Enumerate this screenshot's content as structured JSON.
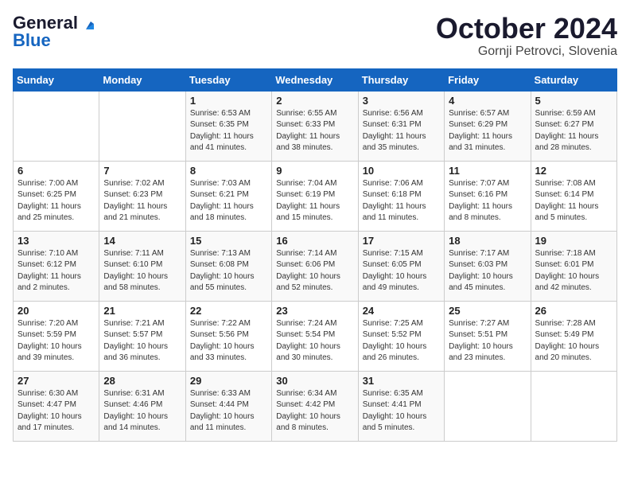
{
  "header": {
    "logo_line1": "General",
    "logo_line2": "Blue",
    "month": "October 2024",
    "location": "Gornji Petrovci, Slovenia"
  },
  "days_of_week": [
    "Sunday",
    "Monday",
    "Tuesday",
    "Wednesday",
    "Thursday",
    "Friday",
    "Saturday"
  ],
  "weeks": [
    [
      {
        "day": "",
        "sunrise": "",
        "sunset": "",
        "daylight": ""
      },
      {
        "day": "",
        "sunrise": "",
        "sunset": "",
        "daylight": ""
      },
      {
        "day": "1",
        "sunrise": "Sunrise: 6:53 AM",
        "sunset": "Sunset: 6:35 PM",
        "daylight": "Daylight: 11 hours and 41 minutes."
      },
      {
        "day": "2",
        "sunrise": "Sunrise: 6:55 AM",
        "sunset": "Sunset: 6:33 PM",
        "daylight": "Daylight: 11 hours and 38 minutes."
      },
      {
        "day": "3",
        "sunrise": "Sunrise: 6:56 AM",
        "sunset": "Sunset: 6:31 PM",
        "daylight": "Daylight: 11 hours and 35 minutes."
      },
      {
        "day": "4",
        "sunrise": "Sunrise: 6:57 AM",
        "sunset": "Sunset: 6:29 PM",
        "daylight": "Daylight: 11 hours and 31 minutes."
      },
      {
        "day": "5",
        "sunrise": "Sunrise: 6:59 AM",
        "sunset": "Sunset: 6:27 PM",
        "daylight": "Daylight: 11 hours and 28 minutes."
      }
    ],
    [
      {
        "day": "6",
        "sunrise": "Sunrise: 7:00 AM",
        "sunset": "Sunset: 6:25 PM",
        "daylight": "Daylight: 11 hours and 25 minutes."
      },
      {
        "day": "7",
        "sunrise": "Sunrise: 7:02 AM",
        "sunset": "Sunset: 6:23 PM",
        "daylight": "Daylight: 11 hours and 21 minutes."
      },
      {
        "day": "8",
        "sunrise": "Sunrise: 7:03 AM",
        "sunset": "Sunset: 6:21 PM",
        "daylight": "Daylight: 11 hours and 18 minutes."
      },
      {
        "day": "9",
        "sunrise": "Sunrise: 7:04 AM",
        "sunset": "Sunset: 6:19 PM",
        "daylight": "Daylight: 11 hours and 15 minutes."
      },
      {
        "day": "10",
        "sunrise": "Sunrise: 7:06 AM",
        "sunset": "Sunset: 6:18 PM",
        "daylight": "Daylight: 11 hours and 11 minutes."
      },
      {
        "day": "11",
        "sunrise": "Sunrise: 7:07 AM",
        "sunset": "Sunset: 6:16 PM",
        "daylight": "Daylight: 11 hours and 8 minutes."
      },
      {
        "day": "12",
        "sunrise": "Sunrise: 7:08 AM",
        "sunset": "Sunset: 6:14 PM",
        "daylight": "Daylight: 11 hours and 5 minutes."
      }
    ],
    [
      {
        "day": "13",
        "sunrise": "Sunrise: 7:10 AM",
        "sunset": "Sunset: 6:12 PM",
        "daylight": "Daylight: 11 hours and 2 minutes."
      },
      {
        "day": "14",
        "sunrise": "Sunrise: 7:11 AM",
        "sunset": "Sunset: 6:10 PM",
        "daylight": "Daylight: 10 hours and 58 minutes."
      },
      {
        "day": "15",
        "sunrise": "Sunrise: 7:13 AM",
        "sunset": "Sunset: 6:08 PM",
        "daylight": "Daylight: 10 hours and 55 minutes."
      },
      {
        "day": "16",
        "sunrise": "Sunrise: 7:14 AM",
        "sunset": "Sunset: 6:06 PM",
        "daylight": "Daylight: 10 hours and 52 minutes."
      },
      {
        "day": "17",
        "sunrise": "Sunrise: 7:15 AM",
        "sunset": "Sunset: 6:05 PM",
        "daylight": "Daylight: 10 hours and 49 minutes."
      },
      {
        "day": "18",
        "sunrise": "Sunrise: 7:17 AM",
        "sunset": "Sunset: 6:03 PM",
        "daylight": "Daylight: 10 hours and 45 minutes."
      },
      {
        "day": "19",
        "sunrise": "Sunrise: 7:18 AM",
        "sunset": "Sunset: 6:01 PM",
        "daylight": "Daylight: 10 hours and 42 minutes."
      }
    ],
    [
      {
        "day": "20",
        "sunrise": "Sunrise: 7:20 AM",
        "sunset": "Sunset: 5:59 PM",
        "daylight": "Daylight: 10 hours and 39 minutes."
      },
      {
        "day": "21",
        "sunrise": "Sunrise: 7:21 AM",
        "sunset": "Sunset: 5:57 PM",
        "daylight": "Daylight: 10 hours and 36 minutes."
      },
      {
        "day": "22",
        "sunrise": "Sunrise: 7:22 AM",
        "sunset": "Sunset: 5:56 PM",
        "daylight": "Daylight: 10 hours and 33 minutes."
      },
      {
        "day": "23",
        "sunrise": "Sunrise: 7:24 AM",
        "sunset": "Sunset: 5:54 PM",
        "daylight": "Daylight: 10 hours and 30 minutes."
      },
      {
        "day": "24",
        "sunrise": "Sunrise: 7:25 AM",
        "sunset": "Sunset: 5:52 PM",
        "daylight": "Daylight: 10 hours and 26 minutes."
      },
      {
        "day": "25",
        "sunrise": "Sunrise: 7:27 AM",
        "sunset": "Sunset: 5:51 PM",
        "daylight": "Daylight: 10 hours and 23 minutes."
      },
      {
        "day": "26",
        "sunrise": "Sunrise: 7:28 AM",
        "sunset": "Sunset: 5:49 PM",
        "daylight": "Daylight: 10 hours and 20 minutes."
      }
    ],
    [
      {
        "day": "27",
        "sunrise": "Sunrise: 6:30 AM",
        "sunset": "Sunset: 4:47 PM",
        "daylight": "Daylight: 10 hours and 17 minutes."
      },
      {
        "day": "28",
        "sunrise": "Sunrise: 6:31 AM",
        "sunset": "Sunset: 4:46 PM",
        "daylight": "Daylight: 10 hours and 14 minutes."
      },
      {
        "day": "29",
        "sunrise": "Sunrise: 6:33 AM",
        "sunset": "Sunset: 4:44 PM",
        "daylight": "Daylight: 10 hours and 11 minutes."
      },
      {
        "day": "30",
        "sunrise": "Sunrise: 6:34 AM",
        "sunset": "Sunset: 4:42 PM",
        "daylight": "Daylight: 10 hours and 8 minutes."
      },
      {
        "day": "31",
        "sunrise": "Sunrise: 6:35 AM",
        "sunset": "Sunset: 4:41 PM",
        "daylight": "Daylight: 10 hours and 5 minutes."
      },
      {
        "day": "",
        "sunrise": "",
        "sunset": "",
        "daylight": ""
      },
      {
        "day": "",
        "sunrise": "",
        "sunset": "",
        "daylight": ""
      }
    ]
  ]
}
